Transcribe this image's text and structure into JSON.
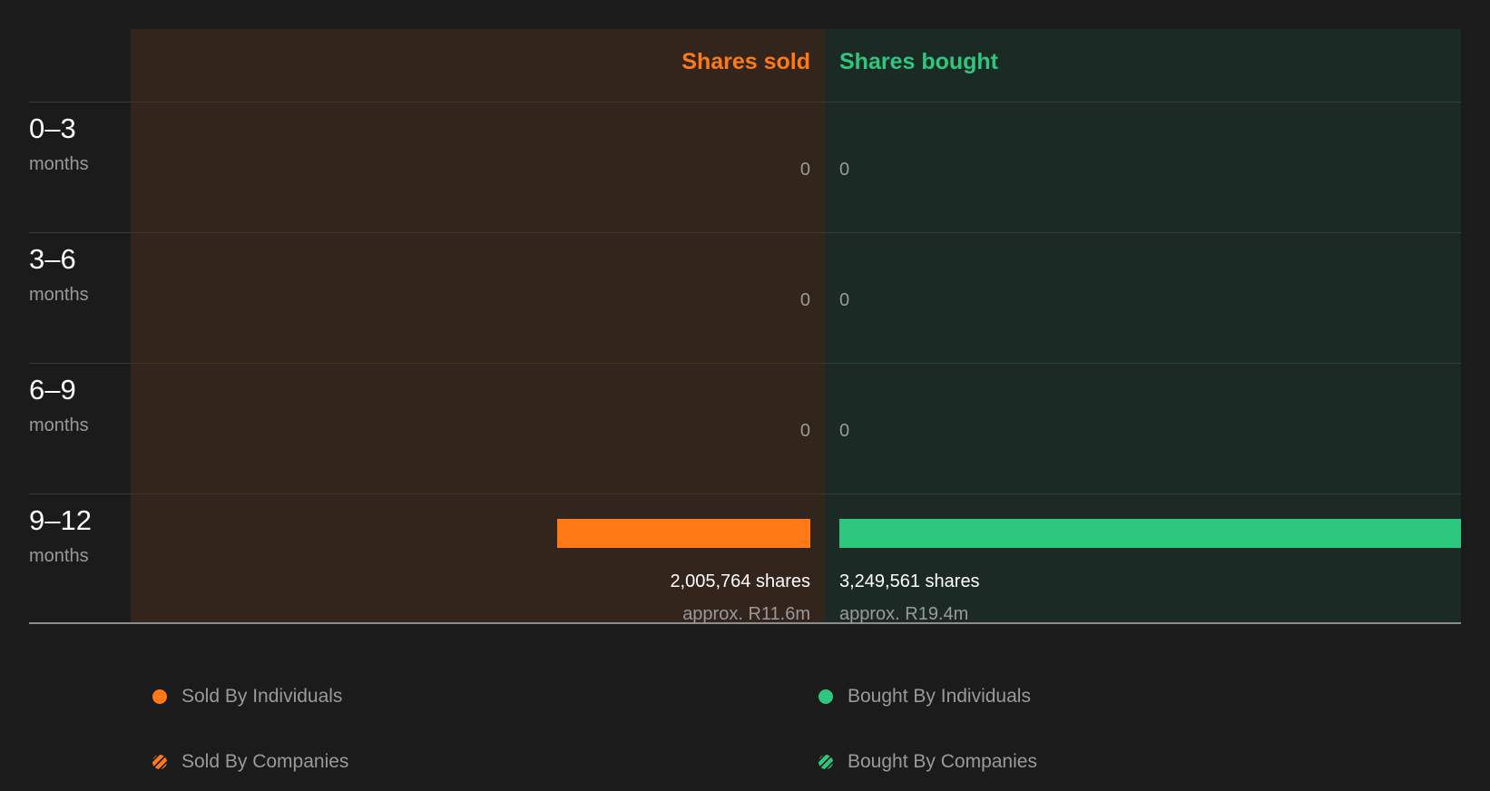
{
  "chart_data": {
    "type": "bar",
    "layout": "diverging-horizontal",
    "headers": {
      "sold": "Shares sold",
      "bought": "Shares bought"
    },
    "colors": {
      "sold": "#ff7a16",
      "bought": "#2ec77e",
      "sold_bg": "#33241c",
      "bought_bg": "#1c2a25"
    },
    "rows": [
      {
        "range": "0–3",
        "unit": "months",
        "sold": 0,
        "bought": 0,
        "sold_label": "0",
        "bought_label": "0"
      },
      {
        "range": "3–6",
        "unit": "months",
        "sold": 0,
        "bought": 0,
        "sold_label": "0",
        "bought_label": "0"
      },
      {
        "range": "6–9",
        "unit": "months",
        "sold": 0,
        "bought": 0,
        "sold_label": "0",
        "bought_label": "0"
      },
      {
        "range": "9–12",
        "unit": "months",
        "sold": 2005764,
        "bought": 3249561,
        "sold_label": "2,005,764 shares",
        "bought_label": "3,249,561 shares",
        "sold_approx": "approx. R11.6m",
        "bought_approx": "approx. R19.4m"
      }
    ],
    "legend": [
      {
        "label": "Sold By Individuals",
        "color": "#ff7a16",
        "style": "solid"
      },
      {
        "label": "Bought By Individuals",
        "color": "#2ec77e",
        "style": "solid"
      },
      {
        "label": "Sold By Companies",
        "color": "#ff7a16",
        "style": "hatched"
      },
      {
        "label": "Bought By Companies",
        "color": "#2ec77e",
        "style": "hatched"
      }
    ]
  }
}
